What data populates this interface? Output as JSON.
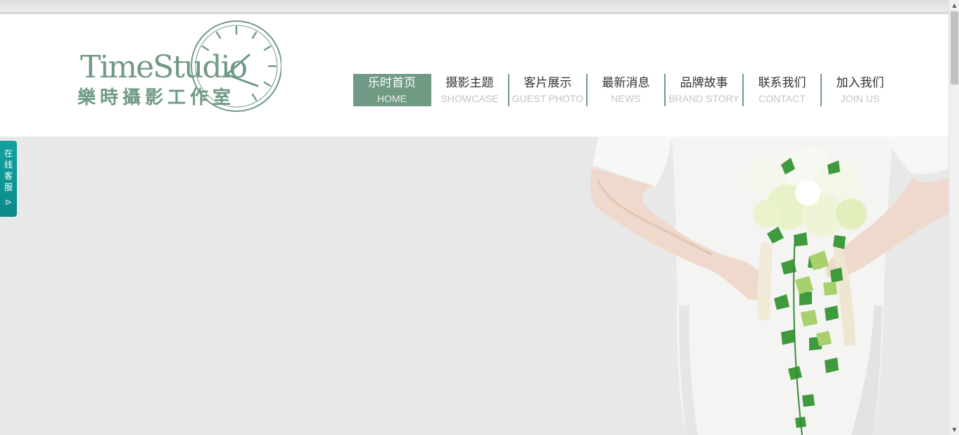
{
  "brand": {
    "name_latin": "TimeStudio",
    "name_cjk": "樂時攝影工作室",
    "color": "#6f9a83"
  },
  "nav": {
    "items": [
      {
        "zh": "乐时首页",
        "en": "HOME",
        "active": true
      },
      {
        "zh": "摄影主题",
        "en": "SHOWCASE"
      },
      {
        "zh": "客片展示",
        "en": "GUEST PHOTO"
      },
      {
        "zh": "最新消息",
        "en": "NEWS"
      },
      {
        "zh": "品牌故事",
        "en": "BRAND STORY"
      },
      {
        "zh": "联系我们",
        "en": "CONTACT"
      },
      {
        "zh": "加入我们",
        "en": "JOIN US"
      }
    ]
  },
  "service": {
    "label": "在线客服",
    "arrow_icon": "chevron-right-icon",
    "color": "#13a2a0"
  },
  "banner": {
    "background": "#e8e8e8",
    "image_icon": "bride-with-bouquet-photo"
  },
  "scrollbar": {
    "up_glyph": "▲",
    "down_glyph": "▼"
  }
}
